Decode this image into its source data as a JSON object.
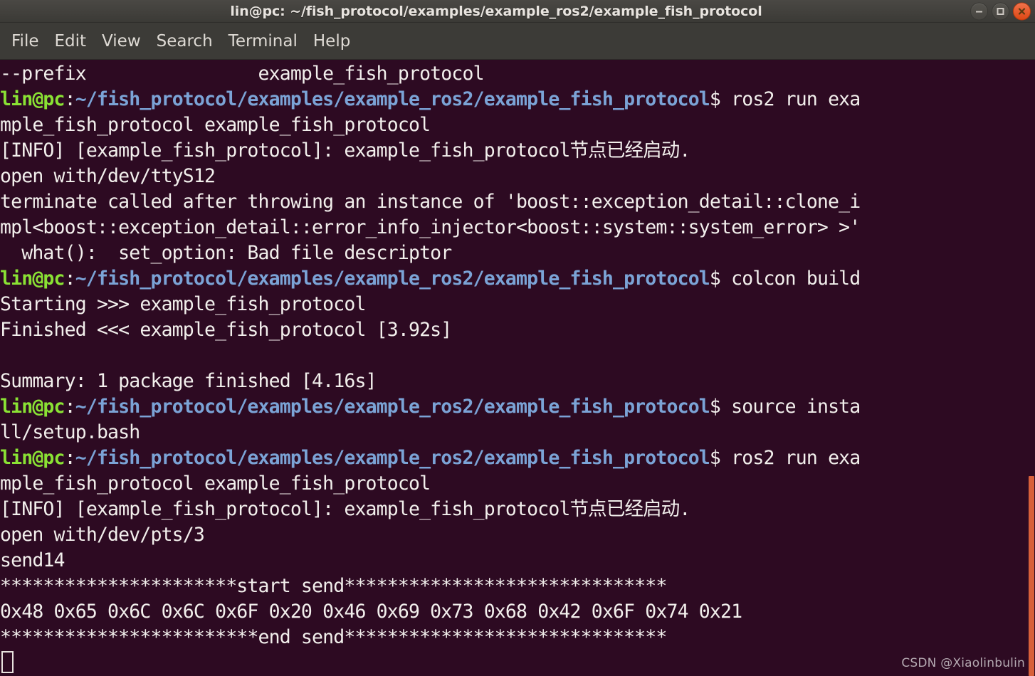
{
  "window": {
    "title": "lin@pc: ~/fish_protocol/examples/example_ros2/example_fish_protocol",
    "buttons": {
      "minimize": "minimize",
      "maximize": "maximize",
      "close": "close"
    }
  },
  "menubar": {
    "items": [
      {
        "label": "File"
      },
      {
        "label": "Edit"
      },
      {
        "label": "View"
      },
      {
        "label": "Search"
      },
      {
        "label": "Terminal"
      },
      {
        "label": "Help"
      }
    ]
  },
  "colors": {
    "background": "#2D0A22",
    "foreground": "#F2EFEC",
    "prompt_user": "#8AE234",
    "prompt_path": "#7BA3D6",
    "titlebar": "#3B3A36",
    "menubar": "#3C3B37",
    "close_button": "#DD4814",
    "scrollbar": "#D8603A"
  },
  "prompt": {
    "user": "lin@pc",
    "colon": ":",
    "path": "~/fish_protocol/examples/example_ros2/example_fish_protocol",
    "sigil": "$ "
  },
  "terminal": {
    "lines": [
      {
        "type": "output",
        "text": "--prefix                example_fish_protocol"
      },
      {
        "type": "prompt",
        "command": "ros2 run exa"
      },
      {
        "type": "output",
        "text": "mple_fish_protocol example_fish_protocol"
      },
      {
        "type": "output",
        "text": "[INFO] [example_fish_protocol]: example_fish_protocol节点已经启动."
      },
      {
        "type": "output",
        "text": "open with/dev/ttyS12"
      },
      {
        "type": "output",
        "text": "terminate called after throwing an instance of 'boost::exception_detail::clone_i"
      },
      {
        "type": "output",
        "text": "mpl<boost::exception_detail::error_info_injector<boost::system::system_error> >'"
      },
      {
        "type": "output",
        "text": "  what():  set_option: Bad file descriptor"
      },
      {
        "type": "prompt",
        "command": "colcon build"
      },
      {
        "type": "output",
        "text": "Starting >>> example_fish_protocol"
      },
      {
        "type": "output",
        "text": "Finished <<< example_fish_protocol [3.92s]"
      },
      {
        "type": "output",
        "text": ""
      },
      {
        "type": "output",
        "text": "Summary: 1 package finished [4.16s]"
      },
      {
        "type": "prompt",
        "command": "source insta"
      },
      {
        "type": "output",
        "text": "ll/setup.bash"
      },
      {
        "type": "prompt",
        "command": "ros2 run exa"
      },
      {
        "type": "output",
        "text": "mple_fish_protocol example_fish_protocol"
      },
      {
        "type": "output",
        "text": "[INFO] [example_fish_protocol]: example_fish_protocol节点已经启动."
      },
      {
        "type": "output",
        "text": "open with/dev/pts/3"
      },
      {
        "type": "output",
        "text": "send14"
      },
      {
        "type": "output",
        "text": "**********************start send******************************"
      },
      {
        "type": "output",
        "text": "0x48 0x65 0x6C 0x6C 0x6F 0x20 0x46 0x69 0x73 0x68 0x42 0x6F 0x74 0x21"
      },
      {
        "type": "output",
        "text": "************************end send******************************"
      }
    ],
    "cursor": {
      "visible": true,
      "style": "hollow-block"
    }
  },
  "watermark": {
    "text": "CSDN @Xiaolinbulin"
  }
}
